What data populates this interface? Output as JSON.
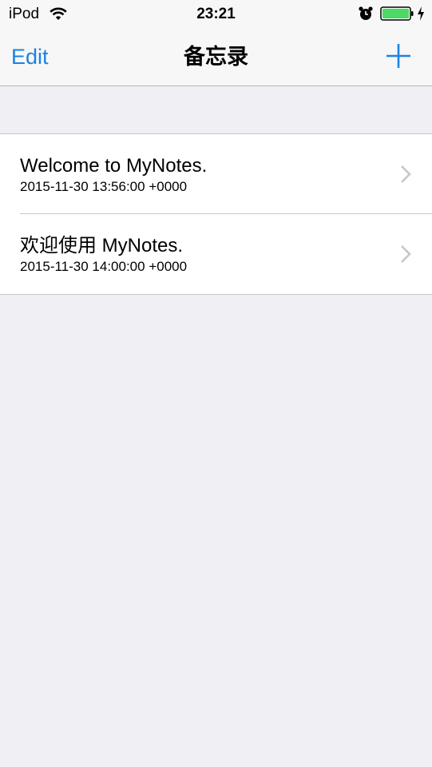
{
  "status_bar": {
    "carrier": "iPod",
    "time": "23:21",
    "icons": [
      "wifi-icon",
      "alarm-icon",
      "battery-icon",
      "charging-icon"
    ],
    "battery_level": 1.0
  },
  "nav": {
    "edit_label": "Edit",
    "title": "备忘录",
    "add_icon": "plus-icon"
  },
  "notes": [
    {
      "title": "Welcome to MyNotes.",
      "date": "2015-11-30 13:56:00 +0000"
    },
    {
      "title": "欢迎使用 MyNotes.",
      "date": "2015-11-30 14:00:00 +0000"
    }
  ],
  "colors": {
    "accent": "#1a82e2",
    "background": "#efeff4",
    "battery": "#4cd964",
    "chevron": "#c7c7cc"
  }
}
